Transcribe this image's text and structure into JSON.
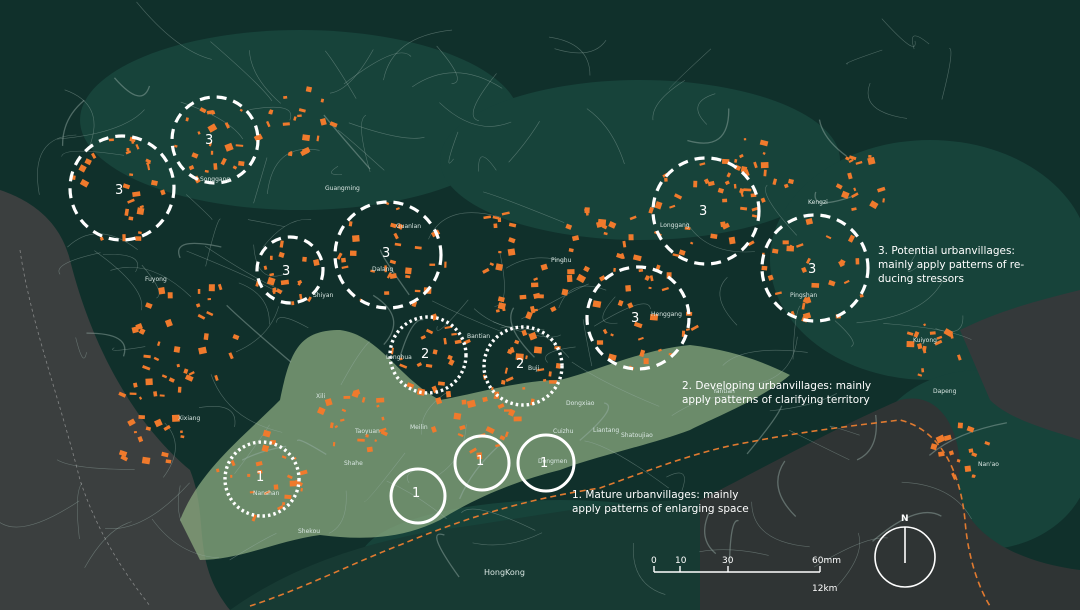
{
  "colors": {
    "background": "#0f2e2a",
    "forest": "#17453b",
    "sea": "#3b3f3f",
    "urban_core": "#8fae82",
    "patch": "#f07a2c",
    "road": "#9db3ad",
    "boundary": "#e07a30",
    "marker": "#ffffff"
  },
  "place_labels": {
    "guangming": "Guangming",
    "songgang": "Songgang",
    "fuyong": "Fuyong",
    "guanlan": "Guanlan",
    "dalang": "Dalang",
    "shiyan": "Shiyan",
    "pinghu": "Pinghu",
    "longgang": "Longgang",
    "kengzi": "Kengzi",
    "pingshan": "Pingshan",
    "henggang": "Henggang",
    "bantian": "Bantian",
    "longhua": "Longhua",
    "buji": "Buji",
    "xili": "Xili",
    "taoyuan": "Taoyuan",
    "meilin": "Meilin",
    "shahe": "Shahe",
    "xixiang": "Xixiang",
    "shekou": "Shekou",
    "nanshan": "Nanshan",
    "dongxiao": "Dongxiao",
    "cuizhu": "Cuizhu",
    "liantang": "Liantang",
    "shatoujiao": "Shatoujiao",
    "dongmen": "Dongmen",
    "kuiyong": "Kuiyong",
    "dapeng": "Dapeng",
    "nanao": "Nan'ao",
    "hongkong": "HongKong",
    "yantian": "Yantian"
  },
  "zones": {
    "potential_number": "3",
    "developing_number": "2",
    "mature_number": "1"
  },
  "annotations": {
    "potential_line1": "3. Potential urbanvillages:",
    "potential_line2": "mainly apply patterns of re-",
    "potential_line3": "ducing stressors",
    "developing_line1": "2. Developing urbanvillages:  mainly",
    "developing_line2": "apply patterns of clarifying territory",
    "mature_line1": "1. Mature urbanvillages:  mainly",
    "mature_line2": "apply patterns of enlarging space"
  },
  "scale_bar": {
    "tick_0": "0",
    "tick_10": "10",
    "tick_30": "30",
    "tick_60": "60mm",
    "distance": "12km"
  },
  "north_arrow": {
    "label": "N"
  }
}
